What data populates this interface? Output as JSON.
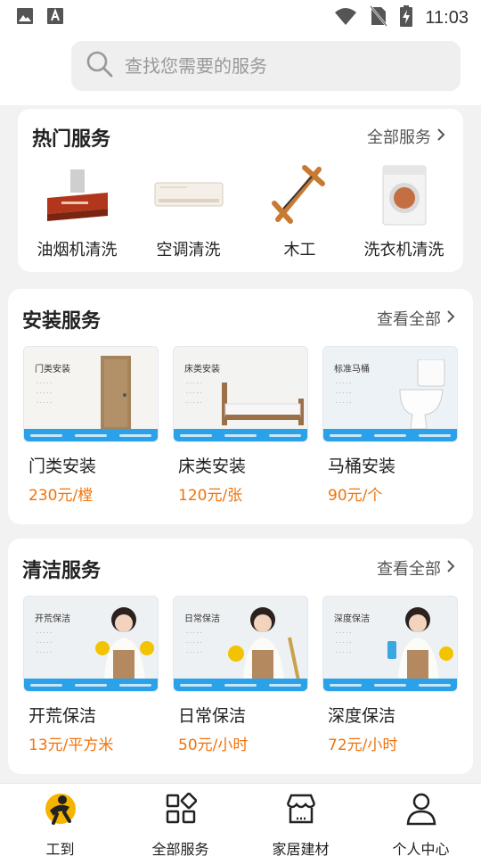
{
  "status_bar": {
    "time": "11:03"
  },
  "search": {
    "placeholder": "查找您需要的服务"
  },
  "hot_services": {
    "title": "热门服务",
    "more_label": "全部服务",
    "items": [
      {
        "label": "油烟机清洗",
        "icon": "range-hood-icon"
      },
      {
        "label": "空调清洗",
        "icon": "air-conditioner-icon"
      },
      {
        "label": "木工",
        "icon": "saw-icon"
      },
      {
        "label": "洗衣机清洗",
        "icon": "washing-machine-icon"
      }
    ]
  },
  "install_services": {
    "title": "安装服务",
    "more_label": "查看全部",
    "items": [
      {
        "name": "门类安装",
        "price": "230元/樘",
        "thumb_tag": "门类安装"
      },
      {
        "name": "床类安装",
        "price": "120元/张",
        "thumb_tag": "床类安装"
      },
      {
        "name": "马桶安装",
        "price": "90元/个",
        "thumb_tag": "标准马桶"
      }
    ]
  },
  "clean_services": {
    "title": "清洁服务",
    "more_label": "查看全部",
    "items": [
      {
        "name": "开荒保洁",
        "price": "13元/平方米",
        "thumb_tag": "开荒保洁"
      },
      {
        "name": "日常保洁",
        "price": "50元/小时",
        "thumb_tag": "日常保洁"
      },
      {
        "name": "深度保洁",
        "price": "72元/小时",
        "thumb_tag": "深度保洁"
      }
    ]
  },
  "tab_bar": {
    "tabs": [
      {
        "label": "工到",
        "icon": "brand-logo-icon"
      },
      {
        "label": "全部服务",
        "icon": "grid-icon"
      },
      {
        "label": "家居建材",
        "icon": "store-icon"
      },
      {
        "label": "个人中心",
        "icon": "person-icon"
      }
    ]
  },
  "colors": {
    "price": "#f0730b",
    "accent": "#f5b400",
    "strip": "#2aa1e8"
  }
}
